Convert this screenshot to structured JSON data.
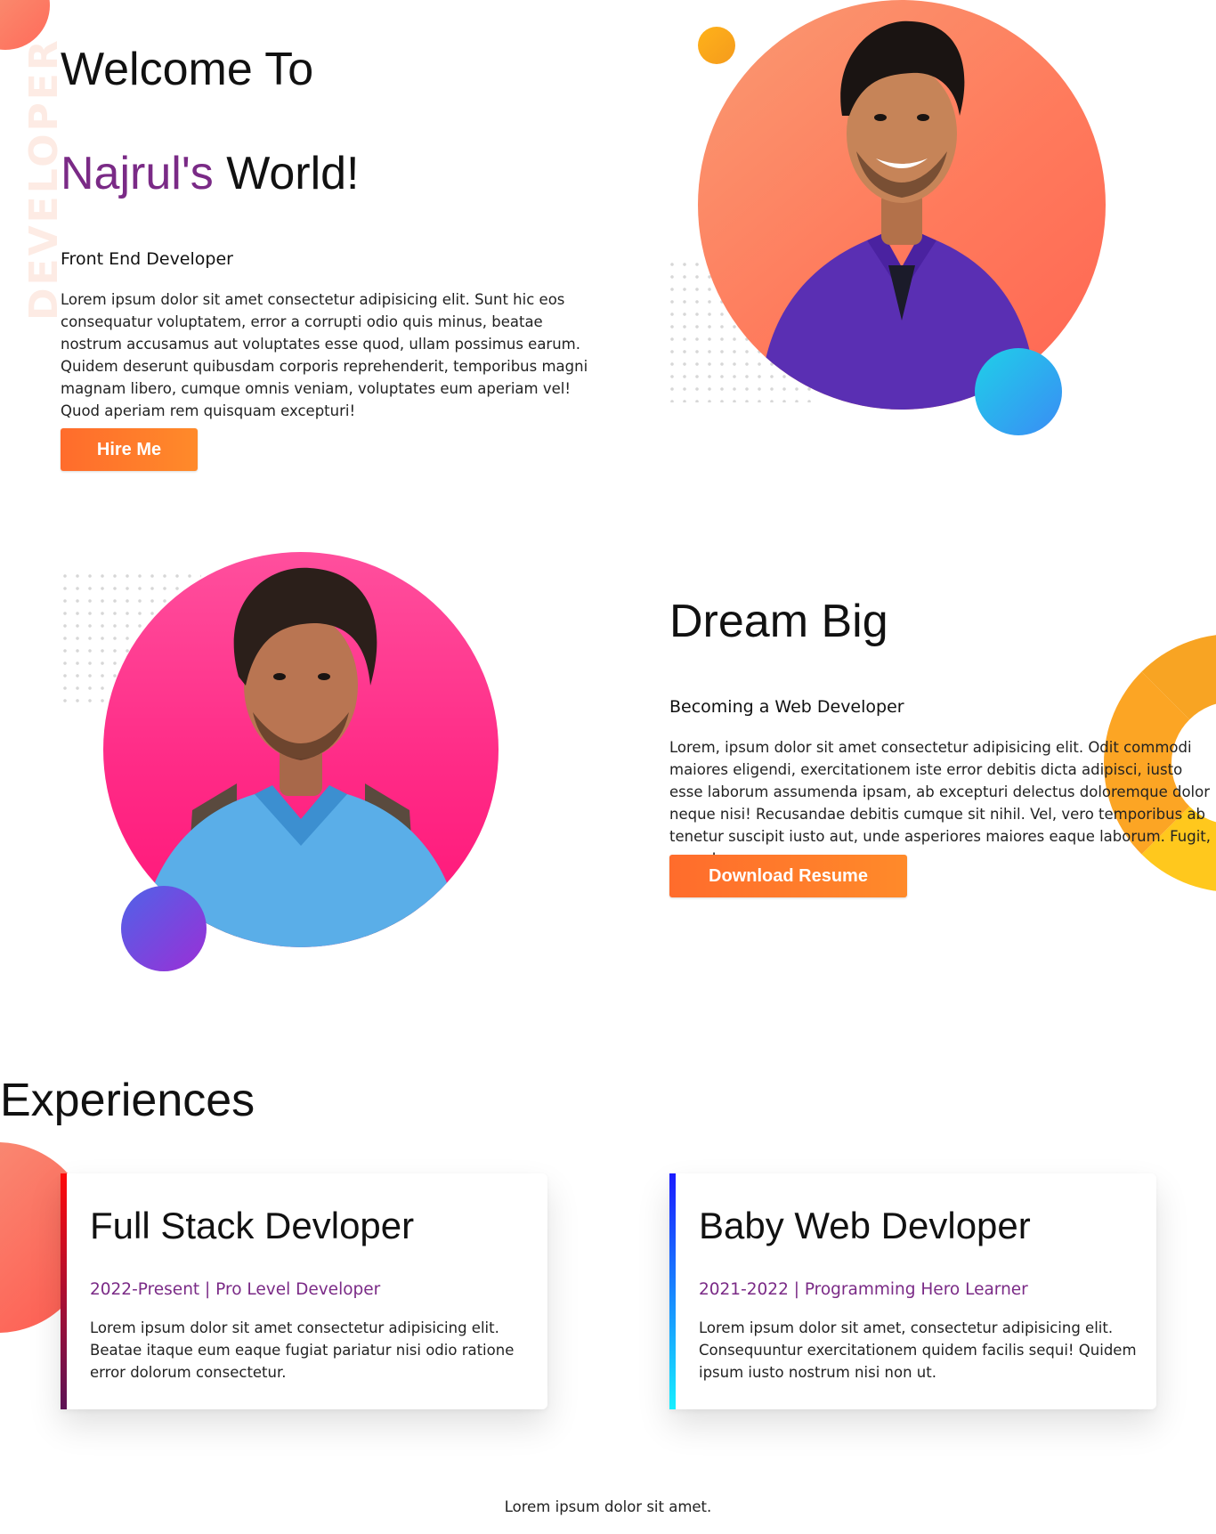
{
  "hero": {
    "side_word": "DEVELOPER",
    "title": "Welcome To",
    "name": "Najrul's",
    "name_suffix": "World!",
    "role": "Front End Developer",
    "description": "Lorem ipsum dolor sit amet consectetur adipisicing elit. Sunt hic eos consequatur voluptatem, error a corrupti odio quis minus, beatae nostrum accusamus aut voluptates esse quod, ullam possimus earum. Quidem deserunt quibusdam corporis reprehenderit, temporibus magni magnam libero, cumque omnis veniam, voluptates eum aperiam vel! Quod aperiam rem quisquam excepturi!",
    "button_label": "Hire Me"
  },
  "dream": {
    "title": "Dream Big",
    "subtitle": "Becoming a Web Developer",
    "description": "Lorem, ipsum dolor sit amet consectetur adipisicing elit. Odit commodi maiores eligendi, exercitationem iste error debitis dicta adipisci, iusto esse laborum assumenda ipsam, ab excepturi delectus doloremque dolor neque nisi! Recusandae debitis cumque sit nihil. Vel, vero temporibus ab tenetur suscipit iusto aut, unde asperiores maiores eaque laborum. Fugit, nemo!",
    "button_label": "Download Resume"
  },
  "experiences": {
    "title": "Experiences",
    "items": [
      {
        "title": "Full Stack Devloper",
        "period": "2022-Present | Pro Level Developer",
        "description": "Lorem ipsum dolor sit amet consectetur adipisicing elit. Beatae itaque eum eaque fugiat pariatur nisi odio ratione error dolorum consectetur."
      },
      {
        "title": "Baby Web Devloper",
        "period": "2021-2022 | Programming Hero Learner",
        "description": "Lorem ipsum dolor sit amet, consectetur adipisicing elit. Consequuntur exercitationem quidem facilis sequi! Quidem ipsum iusto nostrum nisi non ut."
      }
    ]
  },
  "footer": {
    "text": "Lorem ipsum dolor sit amet."
  },
  "colors": {
    "accent_purple": "#7a2a86",
    "button_orange": "#ff7a2a",
    "hero_circle": "#ff7a5c",
    "dream_circle": "#ff2a86",
    "card1_bar": "#ff0a0a",
    "card2_bar": "#1a1aff"
  }
}
